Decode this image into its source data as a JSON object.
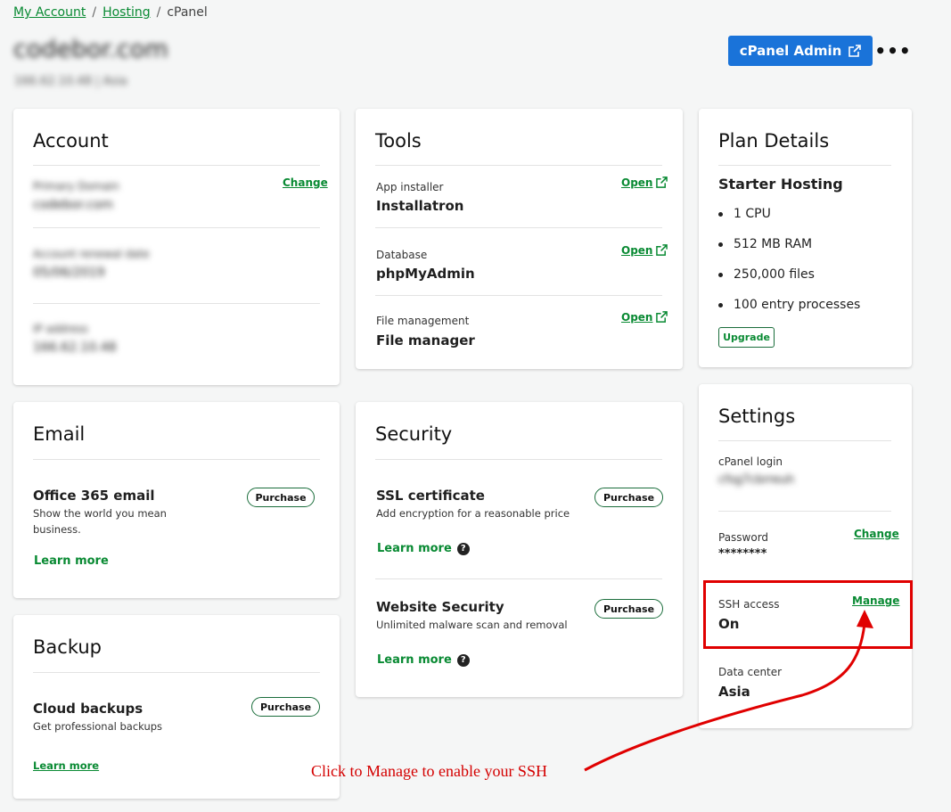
{
  "breadcrumb": {
    "my_account": "My Account",
    "hosting": "Hosting",
    "current": "cPanel",
    "sep": "/"
  },
  "header": {
    "domain": "codebor.com",
    "subline": "166.62.10.48 | Asia",
    "admin_button": "cPanel Admin",
    "more": "•••"
  },
  "account": {
    "title": "Account",
    "change_label": "Change",
    "fields": [
      {
        "label": "Primary Domain",
        "value": "codebor.com"
      },
      {
        "label": "Account renewal date",
        "value": "05/06/2019"
      },
      {
        "label": "IP address",
        "value": "166.62.10.48"
      }
    ]
  },
  "tools": {
    "title": "Tools",
    "open_label": "Open",
    "items": [
      {
        "label": "App installer",
        "value": "Installatron"
      },
      {
        "label": "Database",
        "value": "phpMyAdmin"
      },
      {
        "label": "File management",
        "value": "File manager"
      }
    ]
  },
  "plan": {
    "title": "Plan Details",
    "name": "Starter Hosting",
    "features": [
      "1 CPU",
      "512 MB RAM",
      "250,000 files",
      "100 entry processes"
    ],
    "upgrade_label": "Upgrade"
  },
  "email": {
    "title": "Email",
    "product": "Office 365 email",
    "description_1": "Show the world you mean",
    "description_2": "business.",
    "purchase_label": "Purchase",
    "learn_more": "Learn more"
  },
  "backup": {
    "title": "Backup",
    "product": "Cloud backups",
    "description": "Get professional backups",
    "purchase_label": "Purchase",
    "learn_more": "Learn more"
  },
  "security": {
    "title": "Security",
    "items": [
      {
        "product": "SSL certificate",
        "description": "Add encryption for a reasonable price",
        "purchase_label": "Purchase",
        "learn_more": "Learn more"
      },
      {
        "product": "Website Security",
        "description": "Unlimited malware scan and removal",
        "purchase_label": "Purchase",
        "learn_more": "Learn more"
      }
    ]
  },
  "settings": {
    "title": "Settings",
    "cpanel_login_label": "cPanel login",
    "cpanel_login_value": "cfsg7cbrreuh",
    "password_label": "Password",
    "password_value": "********",
    "change_label": "Change",
    "ssh_label": "SSH access",
    "ssh_value": "On",
    "manage_label": "Manage",
    "datacenter_label": "Data center",
    "datacenter_value": "Asia"
  },
  "annotation": {
    "text": "Click to Manage to enable your SSH",
    "color": "#d40000"
  },
  "colors": {
    "accent_green": "#098a33",
    "primary_blue": "#1a73d9",
    "highlight_red": "#e00000"
  }
}
